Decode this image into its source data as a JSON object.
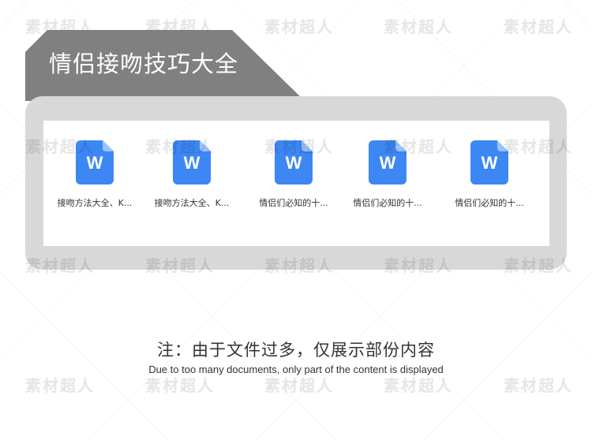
{
  "watermark": {
    "text": "素材超人"
  },
  "folder": {
    "title": "情侣接吻技巧大全"
  },
  "files": [
    {
      "name": "接吻方法大全、K...",
      "icon": "word-document-icon",
      "icon_letter": "W"
    },
    {
      "name": "接吻方法大全、K...",
      "icon": "word-document-icon",
      "icon_letter": "W"
    },
    {
      "name": "情侣们必知的十...",
      "icon": "word-document-icon",
      "icon_letter": "W"
    },
    {
      "name": "情侣们必知的十...",
      "icon": "word-document-icon",
      "icon_letter": "W"
    },
    {
      "name": "情侣们必知的十...",
      "icon": "word-document-icon",
      "icon_letter": "W"
    }
  ],
  "note": {
    "cn": "注：由于文件过多，仅展示部份内容",
    "en": "Due to too many documents, only part of the content is displayed"
  },
  "colors": {
    "folder_tab": "#808080",
    "folder_body": "#d8d8d8",
    "icon_blue": "#3d87f5",
    "icon_fold": "#9cc3fb"
  }
}
